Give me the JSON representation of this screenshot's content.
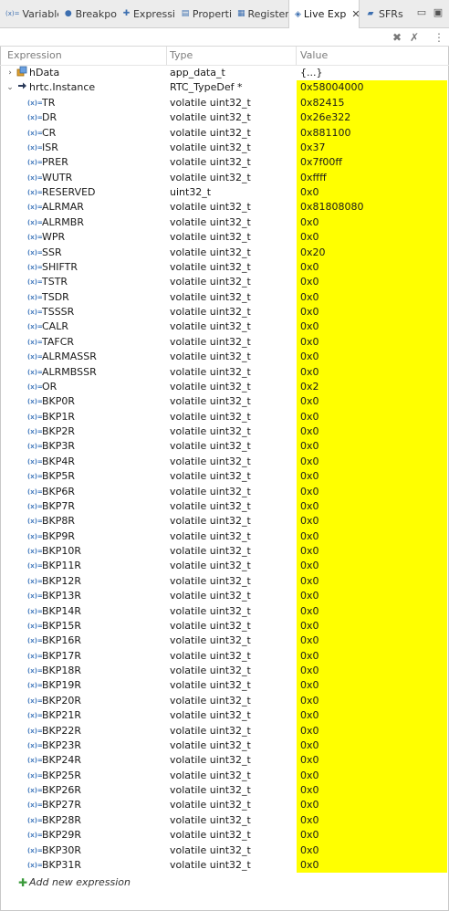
{
  "tabs": [
    {
      "label": "Variable",
      "icon": "(x)=",
      "active": false
    },
    {
      "label": "Breakpo",
      "icon": "●",
      "active": false
    },
    {
      "label": "Expressi",
      "icon": "✚",
      "active": false
    },
    {
      "label": "Properti",
      "icon": "▤",
      "active": false
    },
    {
      "label": "Register",
      "icon": "▦",
      "active": false
    },
    {
      "label": "Live Exp",
      "icon": "◈",
      "active": true
    },
    {
      "label": "SFRs",
      "icon": "▰",
      "active": false
    }
  ],
  "columns": {
    "expression": "Expression",
    "type": "Type",
    "value": "Value"
  },
  "colors": {
    "highlight": "#ffff00",
    "register_icon": "#4a7fc0",
    "struct_icon": "#e0a030"
  },
  "rows": [
    {
      "expr": "hData",
      "type": "app_data_t",
      "value": "{...}",
      "level": 0,
      "twisty": "›",
      "icon": "struct",
      "hl": false
    },
    {
      "expr": "hrtc.Instance",
      "type": "RTC_TypeDef *",
      "value": "0x58004000",
      "level": 0,
      "twisty": "⌄",
      "icon": "pointer",
      "hl": true
    },
    {
      "expr": "TR",
      "type": "volatile uint32_t",
      "value": "0x82415",
      "level": 1,
      "icon": "var",
      "hl": true
    },
    {
      "expr": "DR",
      "type": "volatile uint32_t",
      "value": "0x26e322",
      "level": 1,
      "icon": "var",
      "hl": true
    },
    {
      "expr": "CR",
      "type": "volatile uint32_t",
      "value": "0x881100",
      "level": 1,
      "icon": "var",
      "hl": true
    },
    {
      "expr": "ISR",
      "type": "volatile uint32_t",
      "value": "0x37",
      "level": 1,
      "icon": "var",
      "hl": true
    },
    {
      "expr": "PRER",
      "type": "volatile uint32_t",
      "value": "0x7f00ff",
      "level": 1,
      "icon": "var",
      "hl": true
    },
    {
      "expr": "WUTR",
      "type": "volatile uint32_t",
      "value": "0xffff",
      "level": 1,
      "icon": "var",
      "hl": true
    },
    {
      "expr": "RESERVED",
      "type": "uint32_t",
      "value": "0x0",
      "level": 1,
      "icon": "var",
      "hl": true
    },
    {
      "expr": "ALRMAR",
      "type": "volatile uint32_t",
      "value": "0x81808080",
      "level": 1,
      "icon": "var",
      "hl": true
    },
    {
      "expr": "ALRMBR",
      "type": "volatile uint32_t",
      "value": "0x0",
      "level": 1,
      "icon": "var",
      "hl": true
    },
    {
      "expr": "WPR",
      "type": "volatile uint32_t",
      "value": "0x0",
      "level": 1,
      "icon": "var",
      "hl": true
    },
    {
      "expr": "SSR",
      "type": "volatile uint32_t",
      "value": "0x20",
      "level": 1,
      "icon": "var",
      "hl": true
    },
    {
      "expr": "SHIFTR",
      "type": "volatile uint32_t",
      "value": "0x0",
      "level": 1,
      "icon": "var",
      "hl": true
    },
    {
      "expr": "TSTR",
      "type": "volatile uint32_t",
      "value": "0x0",
      "level": 1,
      "icon": "var",
      "hl": true
    },
    {
      "expr": "TSDR",
      "type": "volatile uint32_t",
      "value": "0x0",
      "level": 1,
      "icon": "var",
      "hl": true
    },
    {
      "expr": "TSSSR",
      "type": "volatile uint32_t",
      "value": "0x0",
      "level": 1,
      "icon": "var",
      "hl": true
    },
    {
      "expr": "CALR",
      "type": "volatile uint32_t",
      "value": "0x0",
      "level": 1,
      "icon": "var",
      "hl": true
    },
    {
      "expr": "TAFCR",
      "type": "volatile uint32_t",
      "value": "0x0",
      "level": 1,
      "icon": "var",
      "hl": true
    },
    {
      "expr": "ALRMASSR",
      "type": "volatile uint32_t",
      "value": "0x0",
      "level": 1,
      "icon": "var",
      "hl": true
    },
    {
      "expr": "ALRMBSSR",
      "type": "volatile uint32_t",
      "value": "0x0",
      "level": 1,
      "icon": "var",
      "hl": true
    },
    {
      "expr": "OR",
      "type": "volatile uint32_t",
      "value": "0x2",
      "level": 1,
      "icon": "var",
      "hl": true
    },
    {
      "expr": "BKP0R",
      "type": "volatile uint32_t",
      "value": "0x0",
      "level": 1,
      "icon": "var",
      "hl": true
    },
    {
      "expr": "BKP1R",
      "type": "volatile uint32_t",
      "value": "0x0",
      "level": 1,
      "icon": "var",
      "hl": true
    },
    {
      "expr": "BKP2R",
      "type": "volatile uint32_t",
      "value": "0x0",
      "level": 1,
      "icon": "var",
      "hl": true
    },
    {
      "expr": "BKP3R",
      "type": "volatile uint32_t",
      "value": "0x0",
      "level": 1,
      "icon": "var",
      "hl": true
    },
    {
      "expr": "BKP4R",
      "type": "volatile uint32_t",
      "value": "0x0",
      "level": 1,
      "icon": "var",
      "hl": true
    },
    {
      "expr": "BKP5R",
      "type": "volatile uint32_t",
      "value": "0x0",
      "level": 1,
      "icon": "var",
      "hl": true
    },
    {
      "expr": "BKP6R",
      "type": "volatile uint32_t",
      "value": "0x0",
      "level": 1,
      "icon": "var",
      "hl": true
    },
    {
      "expr": "BKP7R",
      "type": "volatile uint32_t",
      "value": "0x0",
      "level": 1,
      "icon": "var",
      "hl": true
    },
    {
      "expr": "BKP8R",
      "type": "volatile uint32_t",
      "value": "0x0",
      "level": 1,
      "icon": "var",
      "hl": true
    },
    {
      "expr": "BKP9R",
      "type": "volatile uint32_t",
      "value": "0x0",
      "level": 1,
      "icon": "var",
      "hl": true
    },
    {
      "expr": "BKP10R",
      "type": "volatile uint32_t",
      "value": "0x0",
      "level": 1,
      "icon": "var",
      "hl": true
    },
    {
      "expr": "BKP11R",
      "type": "volatile uint32_t",
      "value": "0x0",
      "level": 1,
      "icon": "var",
      "hl": true
    },
    {
      "expr": "BKP12R",
      "type": "volatile uint32_t",
      "value": "0x0",
      "level": 1,
      "icon": "var",
      "hl": true
    },
    {
      "expr": "BKP13R",
      "type": "volatile uint32_t",
      "value": "0x0",
      "level": 1,
      "icon": "var",
      "hl": true
    },
    {
      "expr": "BKP14R",
      "type": "volatile uint32_t",
      "value": "0x0",
      "level": 1,
      "icon": "var",
      "hl": true
    },
    {
      "expr": "BKP15R",
      "type": "volatile uint32_t",
      "value": "0x0",
      "level": 1,
      "icon": "var",
      "hl": true
    },
    {
      "expr": "BKP16R",
      "type": "volatile uint32_t",
      "value": "0x0",
      "level": 1,
      "icon": "var",
      "hl": true
    },
    {
      "expr": "BKP17R",
      "type": "volatile uint32_t",
      "value": "0x0",
      "level": 1,
      "icon": "var",
      "hl": true
    },
    {
      "expr": "BKP18R",
      "type": "volatile uint32_t",
      "value": "0x0",
      "level": 1,
      "icon": "var",
      "hl": true
    },
    {
      "expr": "BKP19R",
      "type": "volatile uint32_t",
      "value": "0x0",
      "level": 1,
      "icon": "var",
      "hl": true
    },
    {
      "expr": "BKP20R",
      "type": "volatile uint32_t",
      "value": "0x0",
      "level": 1,
      "icon": "var",
      "hl": true
    },
    {
      "expr": "BKP21R",
      "type": "volatile uint32_t",
      "value": "0x0",
      "level": 1,
      "icon": "var",
      "hl": true
    },
    {
      "expr": "BKP22R",
      "type": "volatile uint32_t",
      "value": "0x0",
      "level": 1,
      "icon": "var",
      "hl": true
    },
    {
      "expr": "BKP23R",
      "type": "volatile uint32_t",
      "value": "0x0",
      "level": 1,
      "icon": "var",
      "hl": true
    },
    {
      "expr": "BKP24R",
      "type": "volatile uint32_t",
      "value": "0x0",
      "level": 1,
      "icon": "var",
      "hl": true
    },
    {
      "expr": "BKP25R",
      "type": "volatile uint32_t",
      "value": "0x0",
      "level": 1,
      "icon": "var",
      "hl": true
    },
    {
      "expr": "BKP26R",
      "type": "volatile uint32_t",
      "value": "0x0",
      "level": 1,
      "icon": "var",
      "hl": true
    },
    {
      "expr": "BKP27R",
      "type": "volatile uint32_t",
      "value": "0x0",
      "level": 1,
      "icon": "var",
      "hl": true
    },
    {
      "expr": "BKP28R",
      "type": "volatile uint32_t",
      "value": "0x0",
      "level": 1,
      "icon": "var",
      "hl": true
    },
    {
      "expr": "BKP29R",
      "type": "volatile uint32_t",
      "value": "0x0",
      "level": 1,
      "icon": "var",
      "hl": true
    },
    {
      "expr": "BKP30R",
      "type": "volatile uint32_t",
      "value": "0x0",
      "level": 1,
      "icon": "var",
      "hl": true
    },
    {
      "expr": "BKP31R",
      "type": "volatile uint32_t",
      "value": "0x0",
      "level": 1,
      "icon": "var",
      "hl": true
    }
  ],
  "add_expression_label": "Add new expression"
}
